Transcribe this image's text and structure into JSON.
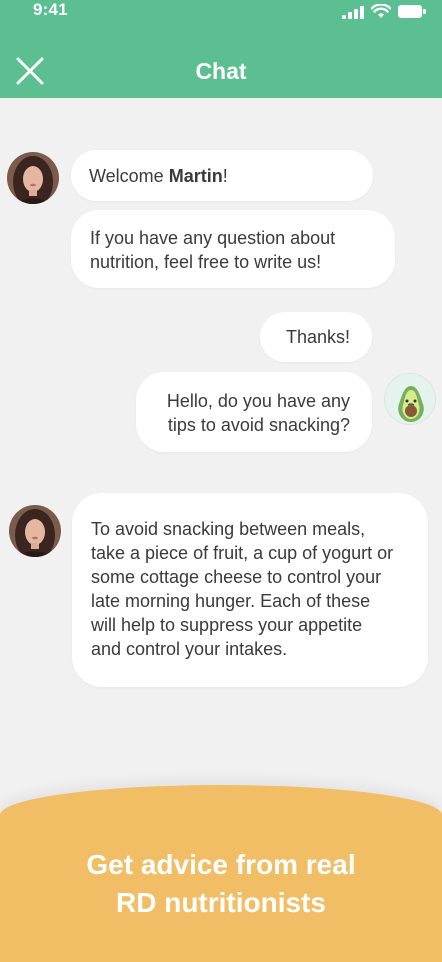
{
  "status_bar": {
    "time": "9:41"
  },
  "header": {
    "title": "Chat",
    "close_icon": "close-icon"
  },
  "messages": {
    "welcome": {
      "prefix": "Welcome ",
      "name": "Martin",
      "suffix": "!"
    },
    "intro": {
      "line1": "If you have any question about",
      "line2": "nutrition, feel free to write us!"
    },
    "thanks": "Thanks!",
    "question": {
      "line1": "Hello, do you have any",
      "line2": "tips to avoid snacking?"
    },
    "answer": {
      "line1": "To avoid snacking between meals,",
      "line2": "take a piece of fruit, a cup of yogurt or",
      "line3": "some cottage cheese to control your",
      "line4": "late morning hunger. Each of these",
      "line5": "will help to suppress your appetite",
      "line6": "and control your intakes."
    }
  },
  "cta": {
    "line1": "Get advice from real",
    "line2": "RD nutritionists"
  },
  "colors": {
    "header": "#5cbf91",
    "cta": "#f2be65",
    "background": "#f1f1f1"
  }
}
